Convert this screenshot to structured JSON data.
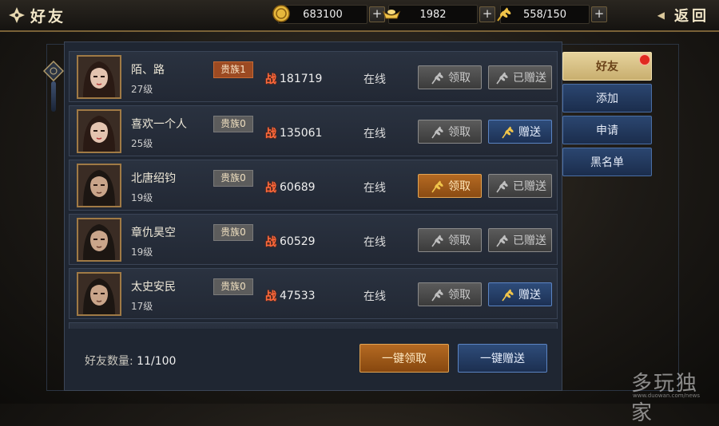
{
  "header": {
    "title": "好友",
    "back_label": "返回",
    "resources": [
      {
        "icon": "gold-coin-icon",
        "value": "683100"
      },
      {
        "icon": "gold-ingot-icon",
        "value": "1982"
      },
      {
        "icon": "golden-wheat-icon",
        "value": "558/150"
      }
    ]
  },
  "friends": [
    {
      "name": "陌、路",
      "level": "27级",
      "rank": "贵族1",
      "rank_tier": "gold",
      "power_label": "战",
      "power": "181719",
      "status": "在线",
      "claim": {
        "label": "领取",
        "state": "disabled"
      },
      "gift": {
        "label": "已赠送",
        "state": "disabled"
      }
    },
    {
      "name": "喜欢一个人",
      "level": "25级",
      "rank": "贵族0",
      "rank_tier": "grey",
      "power_label": "战",
      "power": "135061",
      "status": "在线",
      "claim": {
        "label": "领取",
        "state": "disabled"
      },
      "gift": {
        "label": "赠送",
        "state": "active"
      }
    },
    {
      "name": "北唐绍钧",
      "level": "19级",
      "rank": "贵族0",
      "rank_tier": "grey",
      "power_label": "战",
      "power": "60689",
      "status": "在线",
      "claim": {
        "label": "领取",
        "state": "active"
      },
      "gift": {
        "label": "已赠送",
        "state": "disabled"
      }
    },
    {
      "name": "章仇昊空",
      "level": "19级",
      "rank": "贵族0",
      "rank_tier": "grey",
      "power_label": "战",
      "power": "60529",
      "status": "在线",
      "claim": {
        "label": "领取",
        "state": "disabled"
      },
      "gift": {
        "label": "已赠送",
        "state": "disabled"
      }
    },
    {
      "name": "太史安民",
      "level": "17级",
      "rank": "贵族0",
      "rank_tier": "grey",
      "power_label": "战",
      "power": "47533",
      "status": "在线",
      "claim": {
        "label": "领取",
        "state": "disabled"
      },
      "gift": {
        "label": "赠送",
        "state": "active"
      }
    }
  ],
  "footer": {
    "count_label": "好友数量:",
    "count_value": "11/100",
    "claim_all_label": "一键领取",
    "gift_all_label": "一键赠送"
  },
  "sidebar": {
    "tabs": [
      {
        "label": "好友",
        "active": true,
        "badge": true
      },
      {
        "label": "添加",
        "active": false
      },
      {
        "label": "申请",
        "active": false
      },
      {
        "label": "黑名单",
        "active": false
      }
    ]
  },
  "watermark": {
    "text": "多玩独家",
    "url": "www.duowan.com/news"
  },
  "colors": {
    "accent_gold": "#b56a22",
    "accent_blue": "#2e4c7a",
    "power_red": "#ff6a3c",
    "badge_red": "#e02a20"
  }
}
